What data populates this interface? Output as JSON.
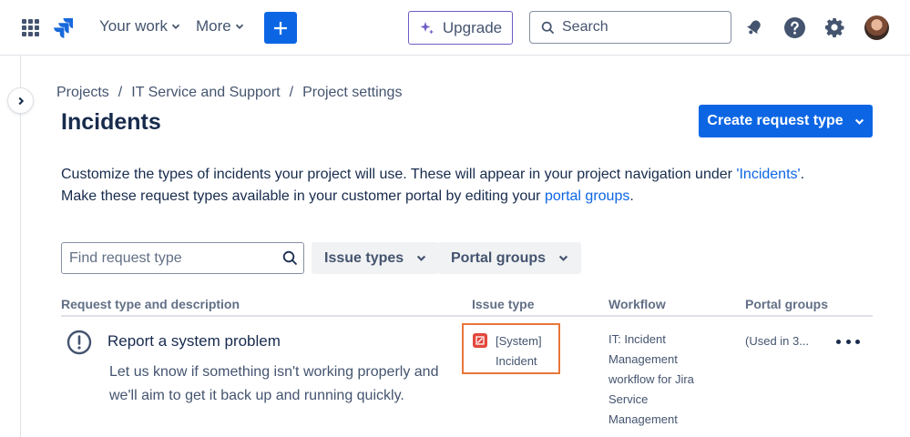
{
  "nav": {
    "your_work": "Your work",
    "more": "More",
    "upgrade": "Upgrade",
    "search_placeholder": "Search"
  },
  "breadcrumb": [
    "Projects",
    "IT Service and Support",
    "Project settings"
  ],
  "page": {
    "title": "Incidents",
    "create_button": "Create request type",
    "desc_line1_prefix": "Customize the types of incidents your project will use. These will appear in your project navigation under ",
    "desc_line1_link": "'Incidents'",
    "desc_line1_suffix": ".",
    "desc_line2_prefix": "Make these request types available in your customer portal by editing your ",
    "desc_line2_link": "portal groups",
    "desc_line2_suffix": "."
  },
  "filters": {
    "find_placeholder": "Find request type",
    "issue_types": "Issue types",
    "portal_groups": "Portal groups"
  },
  "table": {
    "headers": [
      "Request type and description",
      "Issue type",
      "Workflow",
      "Portal groups"
    ],
    "rows": [
      {
        "title": "Report a system problem",
        "description": "Let us know if something isn't working properly and we'll aim to get it back up and running quickly.",
        "issue_type_line1": "[System]",
        "issue_type_line2": "Incident",
        "workflow": "IT: Incident Management workflow for Jira Service Management",
        "portal_groups": "(Used in 3..."
      }
    ]
  },
  "colors": {
    "primary": "#0c66e4",
    "highlight": "#e8763a",
    "incident_icon": "#e2483d",
    "upgrade_border": "#6e5dc6"
  },
  "icons": [
    "app-switcher-icon",
    "jira-logo-icon",
    "plus-icon",
    "sparkle-icon",
    "search-icon",
    "notification-bell-icon",
    "help-icon",
    "settings-gear-icon",
    "chevron-right-icon",
    "warning-circle-icon",
    "incident-icon",
    "more-icon"
  ]
}
